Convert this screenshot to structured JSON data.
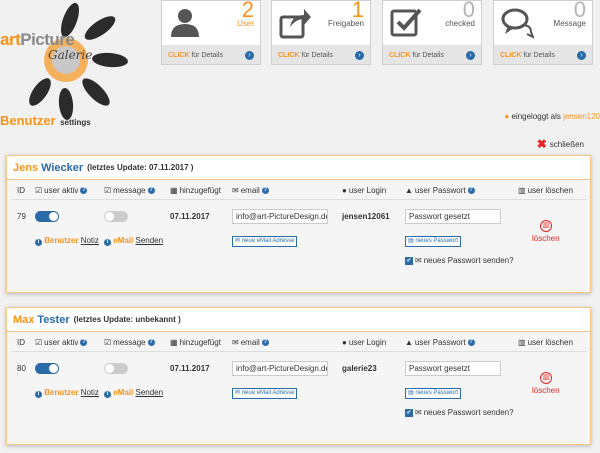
{
  "logo": {
    "art": "art",
    "picture": "Picture",
    "galerie": "Galerie"
  },
  "cards": [
    {
      "number": "2",
      "label": "User",
      "click": "CLICK",
      "details": "für Details",
      "icon": "user-icon"
    },
    {
      "number": "1",
      "label": "Freigaben",
      "click": "CLICK",
      "details": "für Details",
      "icon": "share-icon"
    },
    {
      "number": "0",
      "label": "checked",
      "click": "CLICK",
      "details": "für Details",
      "icon": "check-square-icon"
    },
    {
      "number": "0",
      "label": "Message",
      "click": "CLICK",
      "details": "für Details",
      "icon": "chat-icon"
    }
  ],
  "header": {
    "title": "Benutzer",
    "subtitle": "settings",
    "logged_in_prefix": "eingeloggt als",
    "username": "jensen120",
    "close_label": "schließen"
  },
  "columns": {
    "id": "ID",
    "active": "user aktiv",
    "message": "message",
    "added": "hinzugefügt",
    "email": "email",
    "login": "user Login",
    "password": "user Passwort",
    "delete": "user löschen"
  },
  "users": [
    {
      "first_name": "Jens",
      "last_name": "Wiecker",
      "update_label": "(letztes Update: 07.11.2017 )",
      "id": "79",
      "active": true,
      "message": false,
      "added": "07.11.2017",
      "email": "info@art-PictureDesign.de",
      "new_email_btn": "neue eMail Adresse",
      "login": "jensen12061",
      "password_placeholder": "Passwort gesetzt",
      "new_password_btn": "neues Passwort",
      "send_password_label": "neues Passwort senden?",
      "delete_label": "löschen",
      "note_prefix": "Benutzer",
      "note_link": "Notiz",
      "email_prefix": "eMail",
      "email_link": "Senden"
    },
    {
      "first_name": "Max",
      "last_name": "Tester",
      "update_label": "(letztes Update: unbekannt )",
      "id": "80",
      "active": true,
      "message": false,
      "added": "07.11.2017",
      "email": "info@art-PictureDesign.de",
      "new_email_btn": "neue eMail Adresse",
      "login": "galerie23",
      "password_placeholder": "Passwort gesetzt",
      "new_password_btn": "neues Passwort",
      "send_password_label": "neues Passwort senden?",
      "delete_label": "löschen",
      "note_prefix": "Benutzer",
      "note_link": "Notiz",
      "email_prefix": "eMail",
      "email_link": "Senden"
    }
  ],
  "colors": {
    "accent": "#f7941d",
    "blue": "#2a6aa8",
    "danger": "#e22222"
  }
}
